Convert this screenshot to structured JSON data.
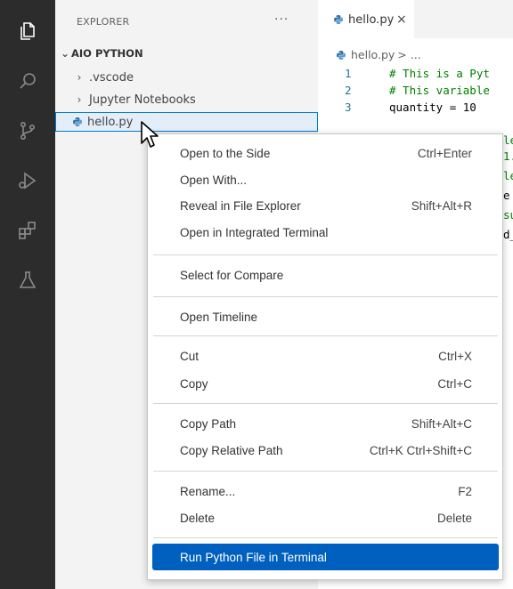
{
  "colors": {
    "activity_bar": "#2c2c2c",
    "accent": "#0078d4",
    "menu_highlight": "#0060c0"
  },
  "activity_icons": [
    "files-icon",
    "search-icon",
    "source-control-icon",
    "run-debug-icon",
    "extensions-icon",
    "testing-icon"
  ],
  "sidebar": {
    "title": "EXPLORER",
    "more": "···",
    "root": "AIO PYTHON",
    "items": [
      {
        "label": ".vscode",
        "icon": "chevron-right"
      },
      {
        "label": "Jupyter Notebooks",
        "icon": "chevron-right"
      },
      {
        "label": "hello.py",
        "icon": "python-file-icon"
      }
    ]
  },
  "editor": {
    "tab_label": "hello.py",
    "tab_close": "×",
    "breadcrumb_file": "hello.py",
    "breadcrumb_rest": "> ...",
    "lines": [
      {
        "n": "1",
        "text": "# This is a Pyt"
      },
      {
        "n": "2",
        "text": "# This variable"
      },
      {
        "n": "3",
        "text": "quantity = 10"
      }
    ],
    "partial_fragments": [
      "le",
      "1.",
      "le",
      "e",
      "su",
      "d_"
    ]
  },
  "context_menu": {
    "items": [
      {
        "label": "Open to the Side",
        "key": "Ctrl+Enter"
      },
      {
        "label": "Open With...",
        "key": ""
      },
      {
        "label": "Reveal in File Explorer",
        "key": "Shift+Alt+R"
      },
      {
        "label": "Open in Integrated Terminal",
        "key": ""
      },
      {
        "label": "Select for Compare",
        "key": ""
      },
      {
        "label": "Open Timeline",
        "key": ""
      },
      {
        "label": "Cut",
        "key": "Ctrl+X"
      },
      {
        "label": "Copy",
        "key": "Ctrl+C"
      },
      {
        "label": "Copy Path",
        "key": "Shift+Alt+C"
      },
      {
        "label": "Copy Relative Path",
        "key": "Ctrl+K Ctrl+Shift+C"
      },
      {
        "label": "Rename...",
        "key": "F2"
      },
      {
        "label": "Delete",
        "key": "Delete"
      },
      {
        "label": "Run Python File in Terminal",
        "key": ""
      }
    ],
    "highlighted": "Run Python File in Terminal"
  }
}
